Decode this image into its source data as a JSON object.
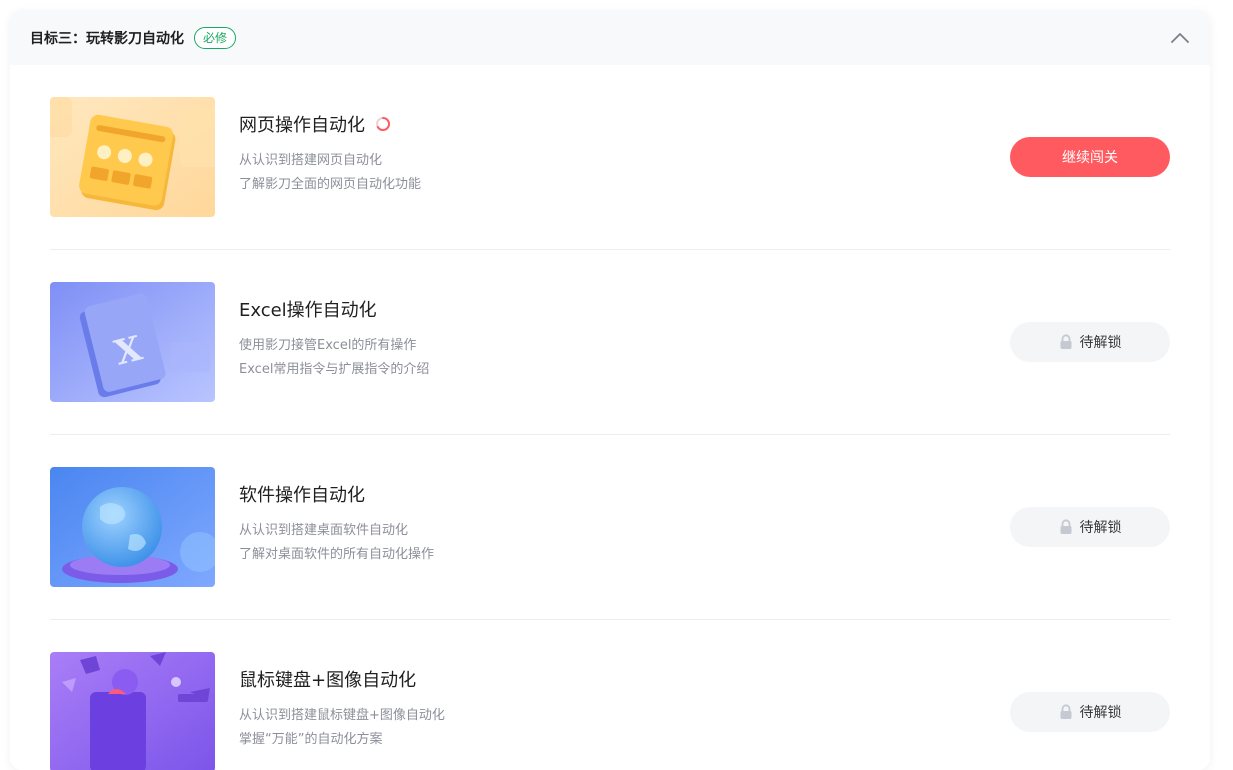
{
  "section": {
    "title": "目标三：玩转影刀自动化",
    "badge": "必修"
  },
  "icons": {
    "collapse": "chevron-up-icon",
    "lock": "lock-icon",
    "progress": "loading-spinner-icon"
  },
  "colors": {
    "accent": "#ff5a5f",
    "badge_green": "#19a863",
    "locked_bg": "#f4f5f7"
  },
  "courses": [
    {
      "title": "网页操作自动化",
      "desc1": "从认识到搭建网页自动化",
      "desc2": "了解影刀全面的网页自动化功能",
      "button": "继续闯关",
      "status": "in-progress"
    },
    {
      "title": "Excel操作自动化",
      "desc1": "使用影刀接管Excel的所有操作",
      "desc2": "Excel常用指令与扩展指令的介绍",
      "button": "待解锁",
      "status": "locked"
    },
    {
      "title": "软件操作自动化",
      "desc1": "从认识到搭建桌面软件自动化",
      "desc2": "了解对桌面软件的所有自动化操作",
      "button": "待解锁",
      "status": "locked"
    },
    {
      "title": "鼠标键盘+图像自动化",
      "desc1": "从认识到搭建鼠标键盘+图像自动化",
      "desc2": "掌握“万能”的自动化方案",
      "button": "待解锁",
      "status": "locked"
    }
  ]
}
